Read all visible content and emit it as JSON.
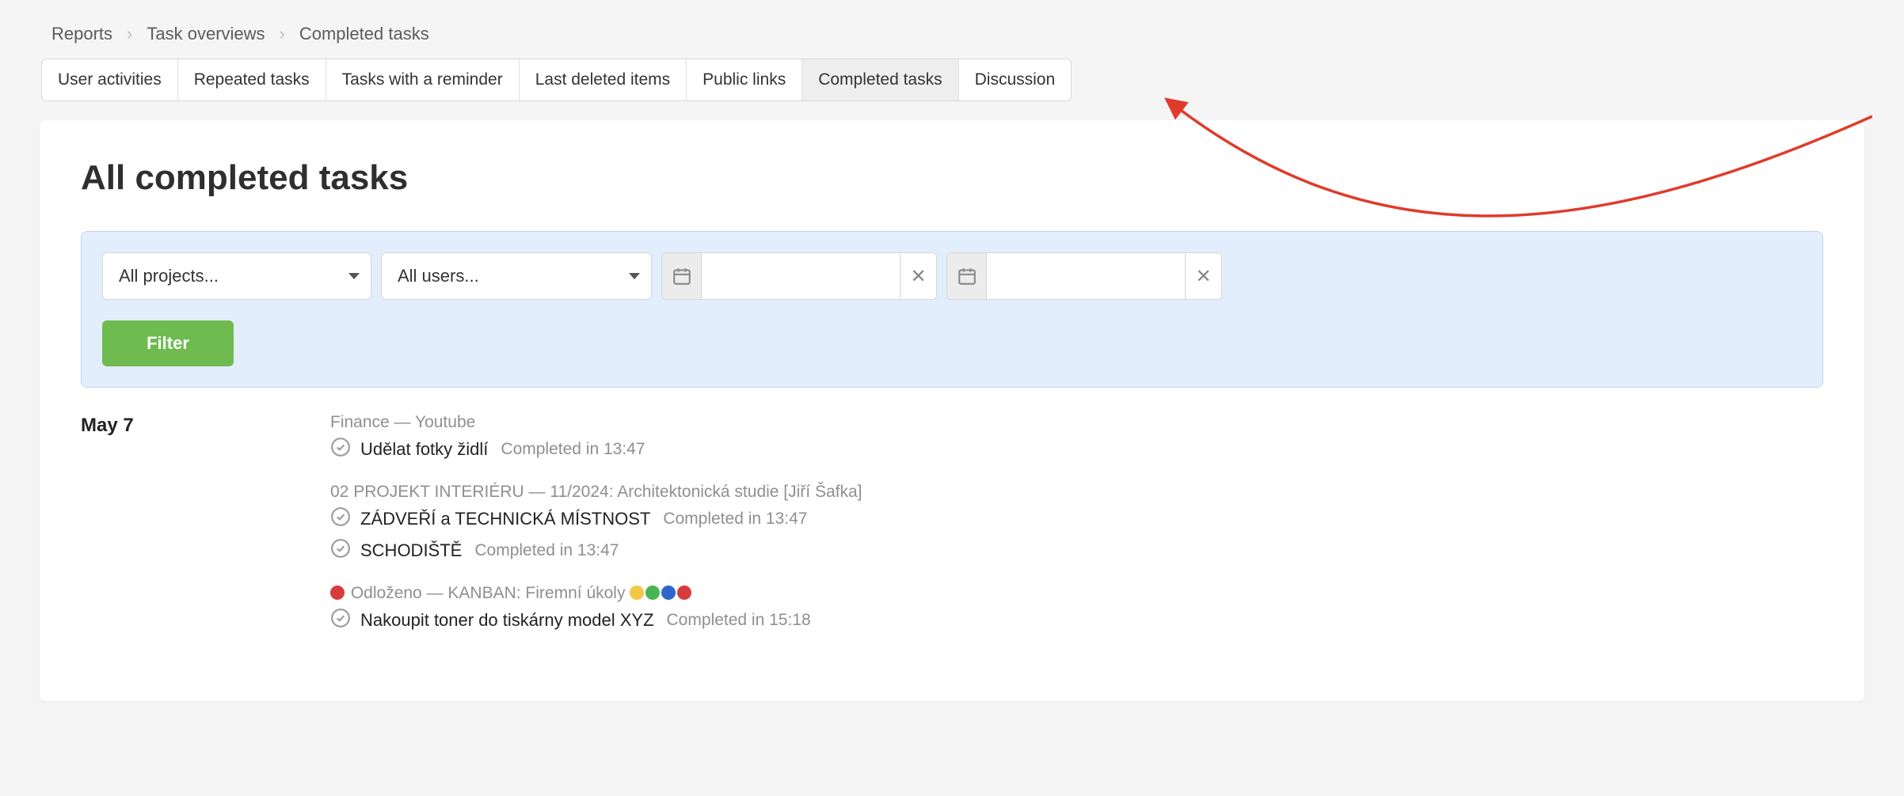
{
  "breadcrumbs": {
    "0": "Reports",
    "1": "Task overviews",
    "2": "Completed tasks"
  },
  "tabs": {
    "0": "User activities",
    "1": "Repeated tasks",
    "2": "Tasks with a reminder",
    "3": "Last deleted items",
    "4": "Public links",
    "5": "Completed tasks",
    "6": "Discussion"
  },
  "page_title": "All completed tasks",
  "filter": {
    "projects_label": "All projects...",
    "users_label": "All users...",
    "date_from": "",
    "date_to": "",
    "button_label": "Filter"
  },
  "date_heading": "May 7",
  "groups": {
    "0": {
      "context": "Finance — Youtube",
      "tasks": {
        "0": {
          "name": "Udělat fotky židlí",
          "completed": "Completed in 13:47"
        }
      }
    },
    "1": {
      "context": "02 PROJEKT INTERIÉRU — 11/2024: Architektonická studie [Jiří Šafka]",
      "tasks": {
        "0": {
          "name": "ZÁDVEŘÍ a TECHNICKÁ MÍSTNOST",
          "completed": "Completed in 13:47"
        },
        "1": {
          "name": "SCHODIŠTĚ",
          "completed": "Completed in 13:47"
        }
      }
    },
    "2": {
      "context_pre": "Odloženo — KANBAN: Firemní úkoly",
      "tasks": {
        "0": {
          "name": "Nakoupit toner do tiskárny model XYZ",
          "completed": "Completed in 15:18"
        }
      }
    }
  }
}
